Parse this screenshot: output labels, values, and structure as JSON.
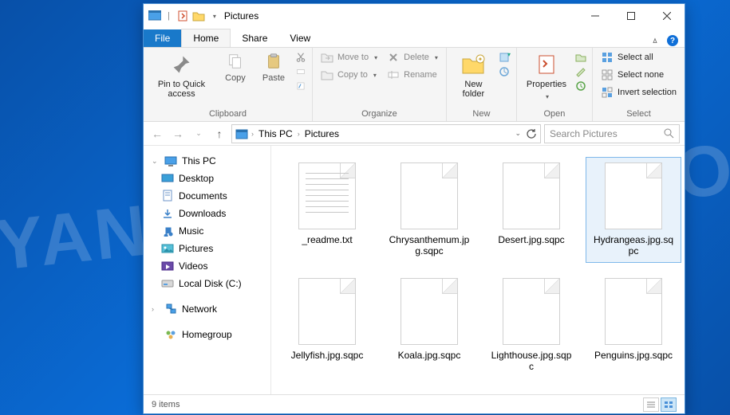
{
  "window": {
    "title": "Pictures"
  },
  "ribbon_tabs": {
    "file": "File",
    "home": "Home",
    "share": "Share",
    "view": "View"
  },
  "ribbon": {
    "clipboard": {
      "label": "Clipboard",
      "pin": "Pin to Quick access",
      "copy": "Copy",
      "paste": "Paste"
    },
    "organize": {
      "label": "Organize",
      "move_to": "Move to",
      "copy_to": "Copy to",
      "delete": "Delete",
      "rename": "Rename"
    },
    "new": {
      "label": "New",
      "new_folder": "New folder"
    },
    "open": {
      "label": "Open",
      "properties": "Properties"
    },
    "select": {
      "label": "Select",
      "select_all": "Select all",
      "select_none": "Select none",
      "invert": "Invert selection"
    }
  },
  "address": {
    "root": "This PC",
    "folder": "Pictures"
  },
  "search": {
    "placeholder": "Search Pictures"
  },
  "nav": {
    "this_pc": "This PC",
    "desktop": "Desktop",
    "documents": "Documents",
    "downloads": "Downloads",
    "music": "Music",
    "pictures": "Pictures",
    "videos": "Videos",
    "local_disk": "Local Disk (C:)",
    "network": "Network",
    "homegroup": "Homegroup"
  },
  "files": [
    {
      "name": "_readme.txt",
      "type": "text",
      "selected": false
    },
    {
      "name": "Chrysanthemum.jpg.sqpc",
      "type": "file",
      "selected": false
    },
    {
      "name": "Desert.jpg.sqpc",
      "type": "file",
      "selected": false
    },
    {
      "name": "Hydrangeas.jpg.sqpc",
      "type": "file",
      "selected": true
    },
    {
      "name": "Jellyfish.jpg.sqpc",
      "type": "file",
      "selected": false
    },
    {
      "name": "Koala.jpg.sqpc",
      "type": "file",
      "selected": false
    },
    {
      "name": "Lighthouse.jpg.sqpc",
      "type": "file",
      "selected": false
    },
    {
      "name": "Penguins.jpg.sqpc",
      "type": "file",
      "selected": false
    }
  ],
  "status": {
    "count": "9 items"
  }
}
